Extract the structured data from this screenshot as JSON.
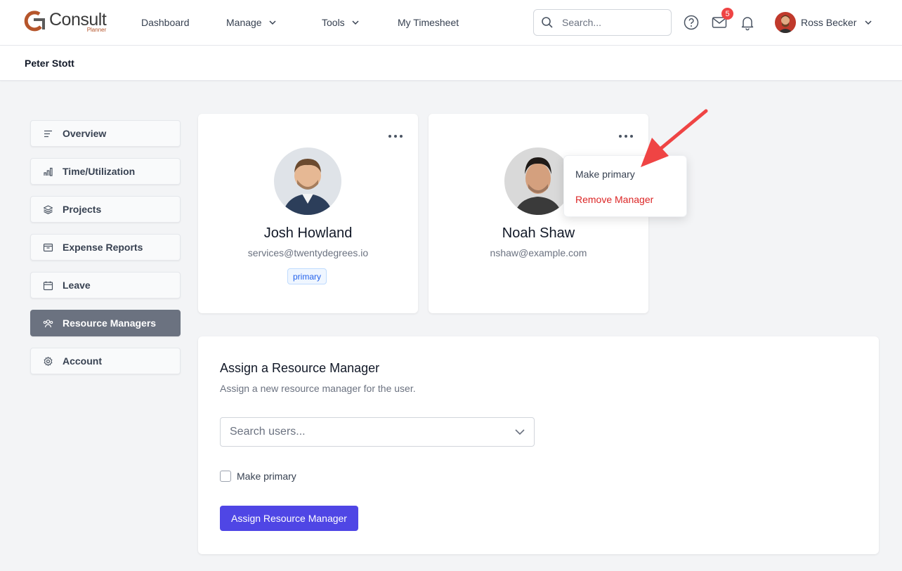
{
  "app": {
    "logo_text": "Consult",
    "logo_sub": "Planner"
  },
  "nav": {
    "items": [
      {
        "label": "Dashboard"
      },
      {
        "label": "Manage"
      },
      {
        "label": "Tools"
      },
      {
        "label": "My Timesheet"
      }
    ],
    "search_placeholder": "Search...",
    "mail_badge": "5",
    "user_name": "Ross Becker"
  },
  "page": {
    "title": "Peter Stott"
  },
  "sidebar": {
    "items": [
      {
        "label": "Overview",
        "icon": "lines-icon"
      },
      {
        "label": "Time/Utilization",
        "icon": "bar-chart-icon"
      },
      {
        "label": "Projects",
        "icon": "layers-icon"
      },
      {
        "label": "Expense Reports",
        "icon": "archive-icon"
      },
      {
        "label": "Leave",
        "icon": "calendar-icon"
      },
      {
        "label": "Resource Managers",
        "icon": "users-icon",
        "active": true
      },
      {
        "label": "Account",
        "icon": "gear-icon"
      }
    ]
  },
  "managers": [
    {
      "name": "Josh Howland",
      "email": "services@twentydegrees.io",
      "badge": "primary"
    },
    {
      "name": "Noah Shaw",
      "email": "nshaw@example.com"
    }
  ],
  "menu": {
    "make_primary": "Make primary",
    "remove": "Remove Manager"
  },
  "assign": {
    "title": "Assign a Resource Manager",
    "description": "Assign a new resource manager for the user.",
    "select_placeholder": "Search users...",
    "checkbox_label": "Make primary",
    "button_label": "Assign Resource Manager"
  },
  "colors": {
    "accent": "#4f46e5",
    "danger": "#dc2626",
    "active_sidebar": "#6b7280",
    "annotation_arrow": "#ef4444"
  }
}
